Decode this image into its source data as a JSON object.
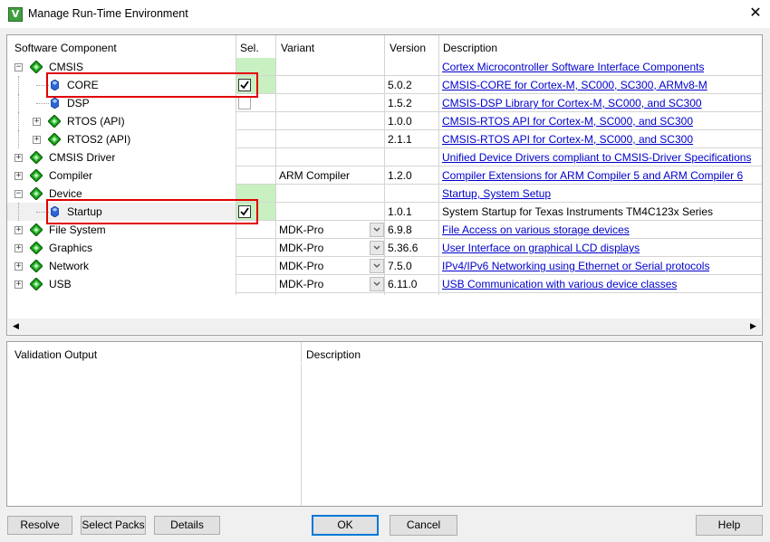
{
  "window": {
    "title": "Manage Run-Time Environment",
    "close_glyph": "✕",
    "app_icon_letter": "V"
  },
  "columns": {
    "component": "Software Component",
    "sel": "Sel.",
    "variant": "Variant",
    "version": "Version",
    "description": "Description"
  },
  "rows": [
    {
      "name": "CMSIS",
      "level": 0,
      "expander": "−",
      "icon": "green-gem-icon",
      "sel": "green",
      "variant": "",
      "version": "",
      "desc": "Cortex Microcontroller Software Interface Components",
      "link": true
    },
    {
      "name": "CORE",
      "level": 1,
      "expander": "",
      "icon": "blue-gem-icon",
      "sel": "checked",
      "variant": "",
      "version": "5.0.2",
      "desc": "CMSIS-CORE for Cortex-M, SC000, SC300, ARMv8-M",
      "link": true
    },
    {
      "name": "DSP",
      "level": 1,
      "expander": "",
      "icon": "blue-gem-icon",
      "sel": "unchecked",
      "variant": "",
      "version": "1.5.2",
      "desc": "CMSIS-DSP Library for Cortex-M, SC000, and SC300",
      "link": true
    },
    {
      "name": "RTOS (API)",
      "level": 1,
      "expander": "+",
      "icon": "green-gem-icon",
      "sel": "",
      "variant": "",
      "version": "1.0.0",
      "desc": "CMSIS-RTOS API for Cortex-M, SC000, and SC300",
      "link": true
    },
    {
      "name": "RTOS2 (API)",
      "level": 1,
      "expander": "+",
      "icon": "green-gem-icon",
      "sel": "",
      "variant": "",
      "version": "2.1.1",
      "desc": "CMSIS-RTOS API for Cortex-M, SC000, and SC300",
      "link": true
    },
    {
      "name": "CMSIS Driver",
      "level": 0,
      "expander": "+",
      "icon": "green-gem-icon",
      "sel": "",
      "variant": "",
      "version": "",
      "desc": "Unified Device Drivers compliant to CMSIS-Driver Specifications",
      "link": true
    },
    {
      "name": "Compiler",
      "level": 0,
      "expander": "+",
      "icon": "green-gem-icon",
      "sel": "",
      "variant": "ARM Compiler",
      "version": "1.2.0",
      "desc": "Compiler Extensions for ARM Compiler 5 and ARM Compiler 6",
      "link": true
    },
    {
      "name": "Device",
      "level": 0,
      "expander": "−",
      "icon": "green-gem-icon",
      "sel": "green",
      "variant": "",
      "version": "",
      "desc": "Startup, System Setup",
      "link": true
    },
    {
      "name": "Startup",
      "level": 1,
      "expander": "",
      "icon": "blue-gem-icon",
      "sel": "checked",
      "variant": "",
      "version": "1.0.1",
      "desc": "System Startup for Texas Instruments TM4C123x Series",
      "link": false,
      "highlight": true
    },
    {
      "name": "File System",
      "level": 0,
      "expander": "+",
      "icon": "green-gem-icon",
      "sel": "",
      "variant": "MDK-Pro",
      "dropdown": true,
      "version": "6.9.8",
      "desc": "File Access on various storage devices",
      "link": true
    },
    {
      "name": "Graphics",
      "level": 0,
      "expander": "+",
      "icon": "green-gem-icon",
      "sel": "",
      "variant": "MDK-Pro",
      "dropdown": true,
      "version": "5.36.6",
      "desc": "User Interface on graphical LCD displays",
      "link": true
    },
    {
      "name": "Network",
      "level": 0,
      "expander": "+",
      "icon": "green-gem-icon",
      "sel": "",
      "variant": "MDK-Pro",
      "dropdown": true,
      "version": "7.5.0",
      "desc": "IPv4/IPv6 Networking using Ethernet or Serial protocols",
      "link": true
    },
    {
      "name": "USB",
      "level": 0,
      "expander": "+",
      "icon": "green-gem-icon",
      "sel": "",
      "variant": "MDK-Pro",
      "dropdown": true,
      "version": "6.11.0",
      "desc": "USB Communication with various device classes",
      "link": true
    }
  ],
  "bottom": {
    "validation_header": "Validation Output",
    "description_header": "Description"
  },
  "buttons": {
    "resolve": "Resolve",
    "select_packs": "Select Packs",
    "details": "Details",
    "ok": "OK",
    "cancel": "Cancel",
    "help": "Help"
  },
  "colors": {
    "link": "#0000cc",
    "selected_green": "#c8f0c0",
    "highlight_red": "#e00000",
    "row_highlight": "#f0f0f0"
  }
}
